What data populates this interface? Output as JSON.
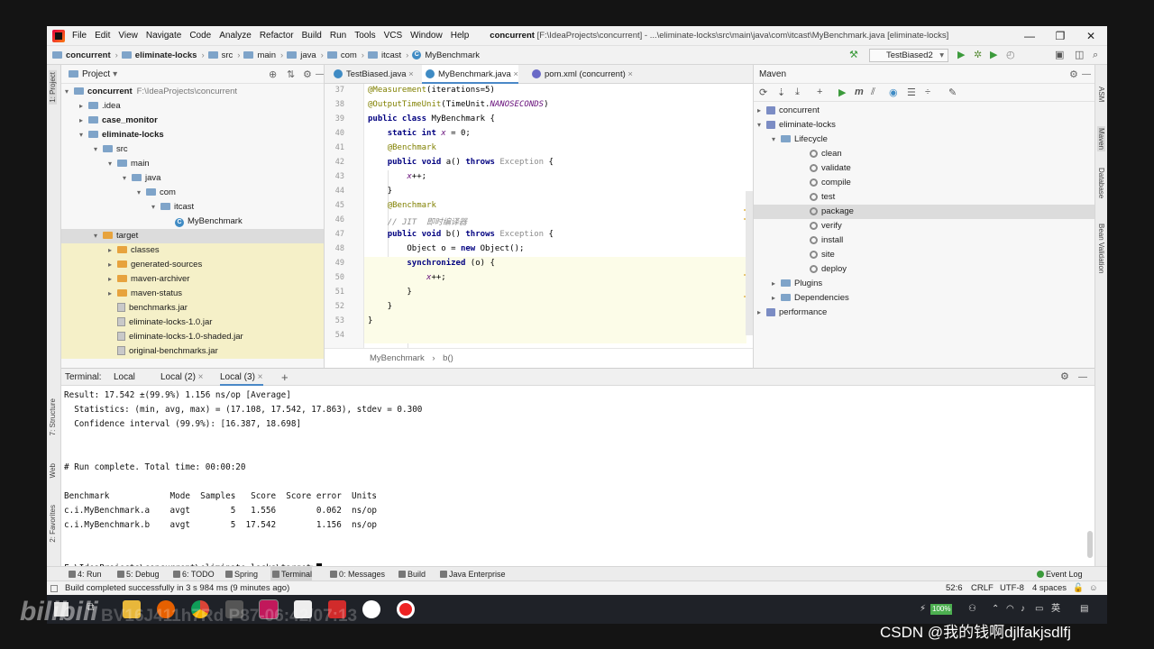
{
  "menu": {
    "items": [
      "File",
      "Edit",
      "View",
      "Navigate",
      "Code",
      "Analyze",
      "Refactor",
      "Build",
      "Run",
      "Tools",
      "VCS",
      "Window",
      "Help"
    ],
    "title_project": "concurrent",
    "title_rest": "[F:\\IdeaProjects\\concurrent] - ...\\eliminate-locks\\src\\main\\java\\com\\itcast\\MyBenchmark.java [eliminate-locks]"
  },
  "breadcrumb": [
    "concurrent",
    "eliminate-locks",
    "src",
    "main",
    "java",
    "com",
    "itcast",
    "MyBenchmark"
  ],
  "run_config": "TestBiased2",
  "left_tabs": [
    "1: Project",
    "7: Structure",
    "Web",
    "2: Favorites"
  ],
  "right_tabs": [
    "ASM",
    "Maven",
    "Database",
    "Bean Validation"
  ],
  "project": {
    "header": "Project",
    "root_name": "concurrent",
    "root_path": "F:\\IdeaProjects\\concurrent",
    "rows": [
      {
        "label": "concurrent",
        "indent": 0,
        "arrow": "▾",
        "icon": "folder",
        "bold": true
      },
      {
        "label": ".idea",
        "indent": 1,
        "arrow": "▸",
        "icon": "folder"
      },
      {
        "label": "case_monitor",
        "indent": 1,
        "arrow": "▸",
        "icon": "folder",
        "bold": true
      },
      {
        "label": "eliminate-locks",
        "indent": 1,
        "arrow": "▾",
        "icon": "folder",
        "bold": true
      },
      {
        "label": "src",
        "indent": 2,
        "arrow": "▾",
        "icon": "folder"
      },
      {
        "label": "main",
        "indent": 3,
        "arrow": "▾",
        "icon": "folder"
      },
      {
        "label": "java",
        "indent": 4,
        "arrow": "▾",
        "icon": "folder"
      },
      {
        "label": "com",
        "indent": 5,
        "arrow": "▾",
        "icon": "folder"
      },
      {
        "label": "itcast",
        "indent": 6,
        "arrow": "▾",
        "icon": "folder"
      },
      {
        "label": "MyBenchmark",
        "indent": 7,
        "arrow": "",
        "icon": "class"
      },
      {
        "label": "target",
        "indent": 2,
        "arrow": "▾",
        "icon": "tfolder",
        "sel": true
      },
      {
        "label": "classes",
        "indent": 3,
        "arrow": "▸",
        "icon": "tfolder",
        "hl": true
      },
      {
        "label": "generated-sources",
        "indent": 3,
        "arrow": "▸",
        "icon": "tfolder",
        "hl": true
      },
      {
        "label": "maven-archiver",
        "indent": 3,
        "arrow": "▸",
        "icon": "tfolder",
        "hl": true
      },
      {
        "label": "maven-status",
        "indent": 3,
        "arrow": "▸",
        "icon": "tfolder",
        "hl": true
      },
      {
        "label": "benchmarks.jar",
        "indent": 3,
        "arrow": "",
        "icon": "jar",
        "hl": true
      },
      {
        "label": "eliminate-locks-1.0.jar",
        "indent": 3,
        "arrow": "",
        "icon": "jar",
        "hl": true
      },
      {
        "label": "eliminate-locks-1.0-shaded.jar",
        "indent": 3,
        "arrow": "",
        "icon": "jar",
        "hl": true
      },
      {
        "label": "original-benchmarks.jar",
        "indent": 3,
        "arrow": "",
        "icon": "jar",
        "hl": true
      }
    ]
  },
  "editor": {
    "tabs": [
      {
        "label": "TestBiased.java",
        "active": false
      },
      {
        "label": "MyBenchmark.java",
        "active": true
      },
      {
        "label": "pom.xml (concurrent)",
        "active": false
      }
    ],
    "line_numbers": [
      "37",
      "38",
      "39",
      "40",
      "41",
      "42",
      "43",
      "44",
      "45",
      "46",
      "47",
      "48",
      "49",
      "50",
      "51",
      "52",
      "53",
      "54"
    ],
    "lines": [
      "<span class=\"an\">@Measurement</span>(iterations=5)",
      "<span class=\"an\">@OutputTimeUnit</span>(TimeUnit.<span class=\"it\">NANOSECONDS</span>)",
      "<span class=\"kw\">public class</span> MyBenchmark {",
      "    <span class=\"kw\">static int</span> <span class=\"fld\">x</span> = 0;",
      "    <span class=\"an\">@Benchmark</span>",
      "    <span class=\"kw\">public void</span> a() <span class=\"kw\">throws</span> <span class=\"ex\">Exception</span> {",
      "        <span class=\"fld\">x</span>++;",
      "    }",
      "    <span class=\"an\">@Benchmark</span>",
      "    <span class=\"cm\">// JIT  即时编译器</span>",
      "    <span class=\"kw\">public void</span> b() <span class=\"kw\">throws</span> <span class=\"ex\">Exception</span> {",
      "        Object o = <span class=\"kw\">new</span> Object();",
      "        <span class=\"kw\">synchronized</span> (o) {",
      "            <span class=\"fld\">x</span>++;",
      "        }",
      "    }",
      "}",
      ""
    ],
    "breadcrumb": [
      "MyBenchmark",
      "b()"
    ]
  },
  "maven": {
    "header": "Maven",
    "rows": [
      {
        "label": "concurrent",
        "indent": 0,
        "arrow": "▸",
        "icon": "mvn"
      },
      {
        "label": "eliminate-locks",
        "indent": 0,
        "arrow": "▾",
        "icon": "mvn"
      },
      {
        "label": "Lifecycle",
        "indent": 1,
        "arrow": "▾",
        "icon": "folder"
      },
      {
        "label": "clean",
        "indent": 3,
        "arrow": "",
        "icon": "gear"
      },
      {
        "label": "validate",
        "indent": 3,
        "arrow": "",
        "icon": "gear"
      },
      {
        "label": "compile",
        "indent": 3,
        "arrow": "",
        "icon": "gear"
      },
      {
        "label": "test",
        "indent": 3,
        "arrow": "",
        "icon": "gear"
      },
      {
        "label": "package",
        "indent": 3,
        "arrow": "",
        "icon": "gear",
        "sel": true
      },
      {
        "label": "verify",
        "indent": 3,
        "arrow": "",
        "icon": "gear"
      },
      {
        "label": "install",
        "indent": 3,
        "arrow": "",
        "icon": "gear"
      },
      {
        "label": "site",
        "indent": 3,
        "arrow": "",
        "icon": "gear"
      },
      {
        "label": "deploy",
        "indent": 3,
        "arrow": "",
        "icon": "gear"
      },
      {
        "label": "Plugins",
        "indent": 1,
        "arrow": "▸",
        "icon": "folder"
      },
      {
        "label": "Dependencies",
        "indent": 1,
        "arrow": "▸",
        "icon": "folder"
      },
      {
        "label": "performance",
        "indent": 0,
        "arrow": "▸",
        "icon": "mvn"
      }
    ]
  },
  "terminal": {
    "label": "Terminal:",
    "tabs": [
      "Local",
      "Local (2)",
      "Local (3)"
    ],
    "active_tab": 2,
    "lines": [
      "Result: 17.542 ±(99.9%) 1.156 ns/op [Average]",
      "  Statistics: (min, avg, max) = (17.108, 17.542, 17.863), stdev = 0.300",
      "  Confidence interval (99.9%): [16.387, 18.698]",
      "",
      "",
      "# Run complete. Total time: 00:00:20",
      "",
      "Benchmark            Mode  Samples   Score  Score error  Units",
      "c.i.MyBenchmark.a    avgt        5   1.556        0.062  ns/op",
      "c.i.MyBenchmark.b    avgt        5  17.542        1.156  ns/op",
      "",
      ""
    ],
    "prompt": "F:\\IdeaProjects\\concurrent\\eliminate-locks\\target>"
  },
  "bottom_tabs": [
    "4: Run",
    "5: Debug",
    "6: TODO",
    "Spring",
    "Terminal",
    "0: Messages",
    "Build",
    "Java Enterprise"
  ],
  "event_log": "Event Log",
  "status": {
    "message": "Build completed successfully in 3 s 984 ms (9 minutes ago)",
    "position": "52:6",
    "line_sep": "CRLF",
    "encoding": "UTF-8",
    "indent": "4 spaces"
  },
  "taskbar": {
    "battery": "100%",
    "ime": "英"
  },
  "watermark": {
    "bilibili_id": "BV16J411h7Rd P87-06:42/07:13",
    "csdn": "CSDN @我的钱啊djlfakjsdlfj"
  }
}
